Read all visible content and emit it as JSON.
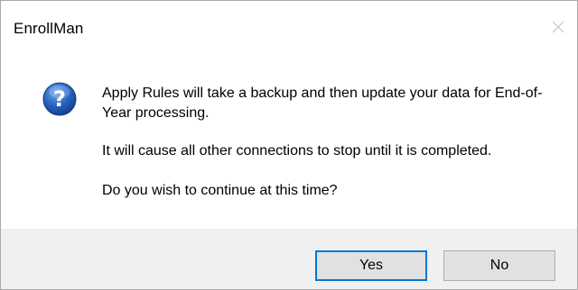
{
  "window": {
    "title": "EnrollMan"
  },
  "dialog": {
    "icon": "question-icon",
    "message_line1": "Apply Rules will take a backup and then update your data for End-of-Year processing.",
    "message_line2": "It will cause all other connections to stop until it is completed.",
    "message_line3": "Do you wish to continue at this time?"
  },
  "buttons": {
    "yes_label": "Yes",
    "no_label": "No"
  },
  "colors": {
    "accent": "#0078d7",
    "icon_blue": "#1f5fb8",
    "footer_bg": "#f0f0f0"
  }
}
